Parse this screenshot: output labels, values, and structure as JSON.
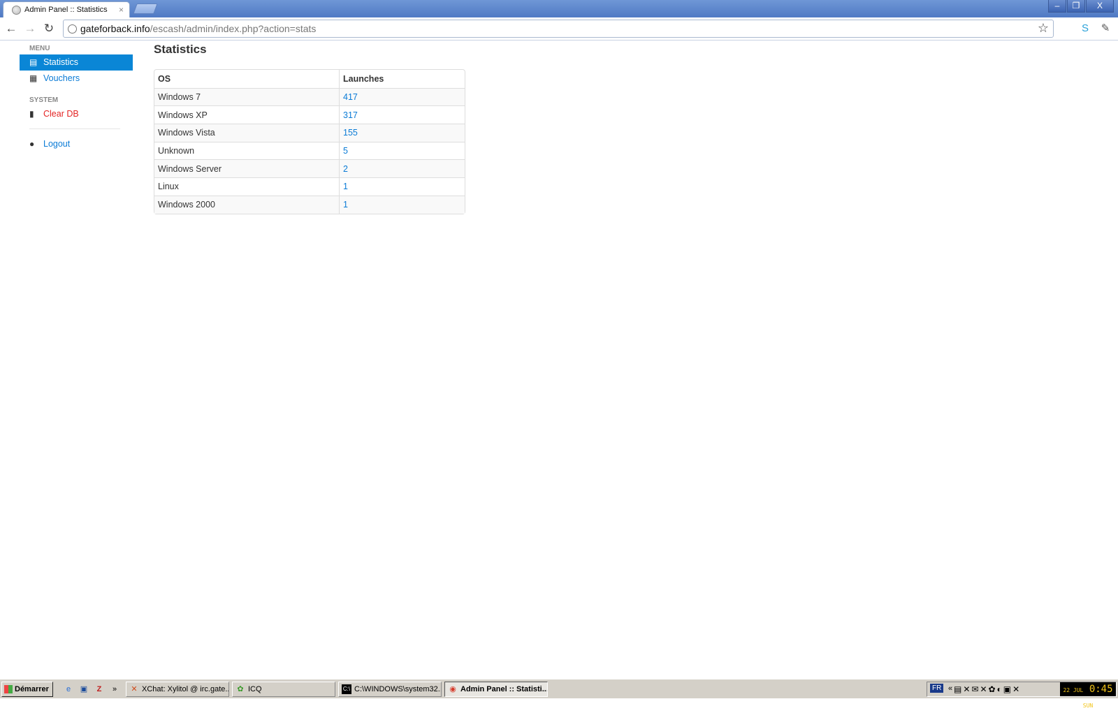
{
  "browser": {
    "tab_title": "Admin Panel :: Statistics",
    "tab_close": "×",
    "url_host": "gateforback.info",
    "url_path": "/escash/admin/index.php?action=stats",
    "window_buttons": [
      "–",
      "❐",
      "X"
    ]
  },
  "sidebar": {
    "menu_header": "MENU",
    "items": [
      {
        "label": "Statistics",
        "icon": "list-icon"
      },
      {
        "label": "Vouchers",
        "icon": "gift-icon"
      }
    ],
    "system_header": "SYSTEM",
    "clear_db": "Clear DB",
    "logout": "Logout"
  },
  "main": {
    "title": "Statistics",
    "table": {
      "headers": [
        "OS",
        "Launches"
      ],
      "rows": [
        [
          "Windows 7",
          "417"
        ],
        [
          "Windows XP",
          "317"
        ],
        [
          "Windows Vista",
          "155"
        ],
        [
          "Unknown",
          "5"
        ],
        [
          "Windows Server",
          "2"
        ],
        [
          "Linux",
          "1"
        ],
        [
          "Windows 2000",
          "1"
        ]
      ]
    }
  },
  "taskbar": {
    "start_label": "Démarrer",
    "chevron": "»",
    "tasks": [
      "XChat: Xylitol @ irc.gate...",
      "ICQ",
      "C:\\WINDOWS\\system32...",
      "Admin Panel :: Statisti..."
    ],
    "lang": "FR",
    "tray_chevron": "«",
    "clock": "0:45",
    "clock_date": "22 JUL",
    "clock_day": "SUN"
  },
  "colors": {
    "accent": "#0a86d6",
    "link": "#0a7bd6",
    "danger": "#e42424"
  }
}
